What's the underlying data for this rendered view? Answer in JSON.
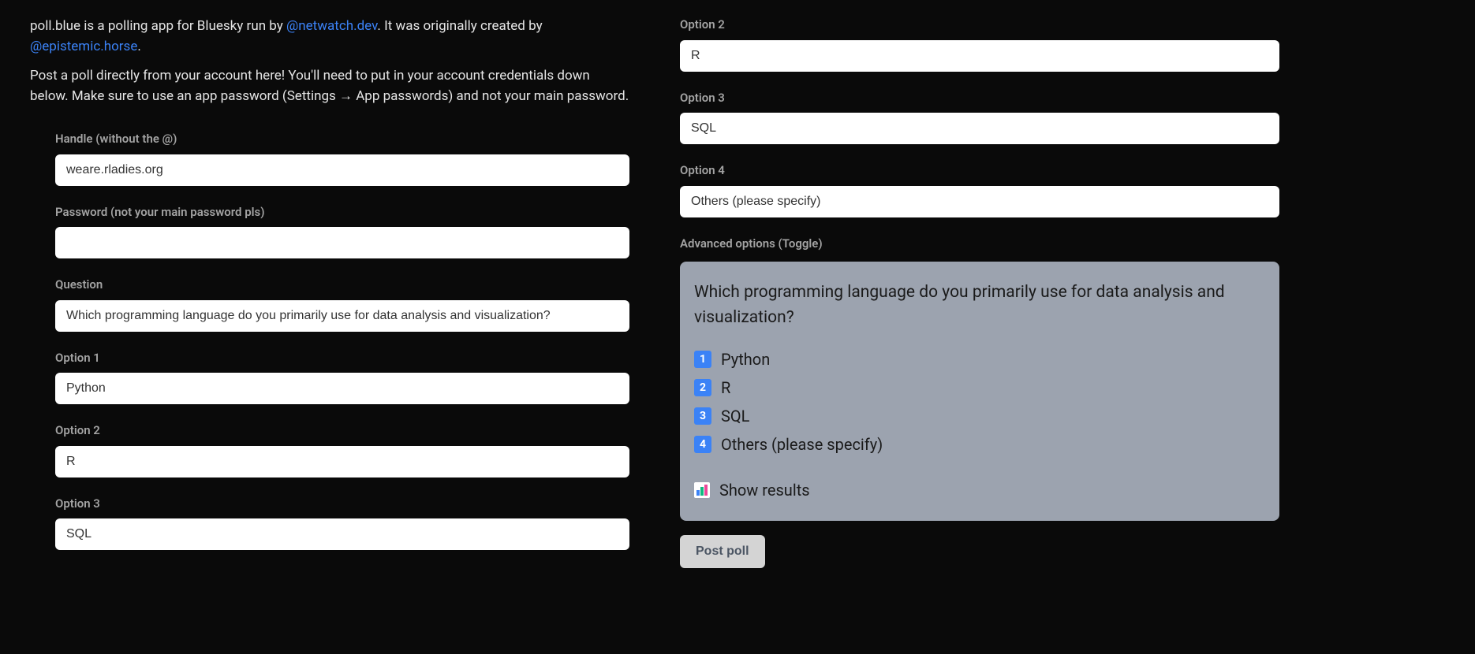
{
  "intro": {
    "text_before_link1": "poll.blue is a polling app for Bluesky run by ",
    "link1": "@netwatch.dev",
    "text_between": ". It was originally created by ",
    "link2": "@epistemic.horse",
    "text_after": ".",
    "paragraph2": "Post a poll directly from your account here! You'll need to put in your account credentials down below. Make sure to use an app password (Settings → App passwords) and not your main password."
  },
  "form": {
    "handle_label": "Handle (without the @)",
    "handle_value": "weare.rladies.org",
    "password_label": "Password (not your main password pls)",
    "password_value": "",
    "question_label": "Question",
    "question_value": "Which programming language do you primarily use for data analysis and visualization?",
    "option1_label": "Option 1",
    "option1_value": "Python",
    "option2_label": "Option 2",
    "option2_value": "R",
    "option3_label": "Option 3",
    "option3_value": "SQL",
    "option4_label": "Option 4",
    "option4_value": "Others (please specify)"
  },
  "right": {
    "option2_label": "Option 2",
    "option2_value": "R",
    "option3_label": "Option 3",
    "option3_value": "SQL",
    "option4_label": "Option 4",
    "option4_value": "Others (please specify)",
    "advanced_label": "Advanced options (Toggle)"
  },
  "preview": {
    "question": "Which programming language do you primarily use for data analysis and visualization?",
    "options": {
      "n1": "1",
      "o1": "Python",
      "n2": "2",
      "o2": "R",
      "n3": "3",
      "o3": "SQL",
      "n4": "4",
      "o4": "Others (please specify)"
    },
    "show_results": "Show results"
  },
  "post_button": "Post poll"
}
